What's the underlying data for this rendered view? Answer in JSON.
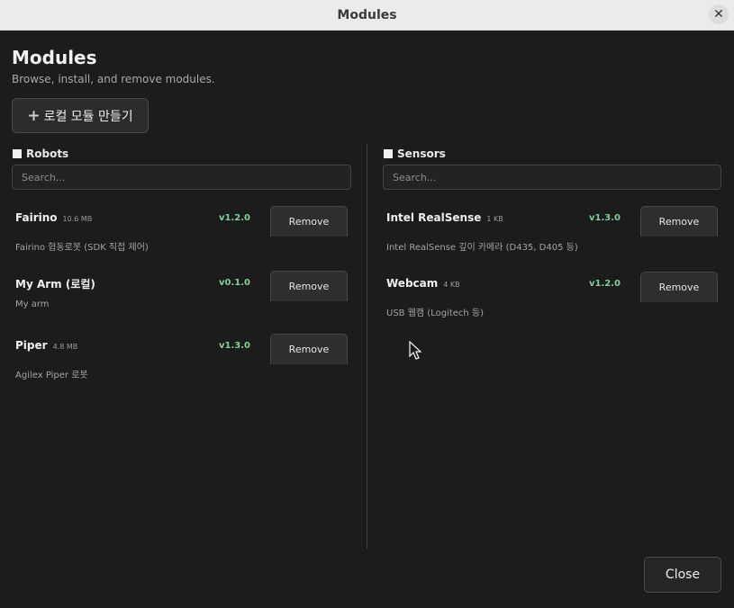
{
  "window": {
    "title": "Modules",
    "close_icon": "close-icon"
  },
  "header": {
    "title": "Modules",
    "subtitle": "Browse, install, and remove modules."
  },
  "toolbar": {
    "create_local_label": "로컬 모듈 만들기",
    "create_local_icon": "plus-icon"
  },
  "robots": {
    "label": "Robots",
    "search_placeholder": "Search...",
    "items": [
      {
        "name": "Fairino",
        "size": "10.6 MB",
        "version": "v1.2.0",
        "description": "Fairino 협동로봇 (SDK 직접 제어)",
        "action": "Remove"
      },
      {
        "name": "My Arm (로컬)",
        "size": "",
        "version": "v0.1.0",
        "description": "My arm",
        "action": "Remove"
      },
      {
        "name": "Piper",
        "size": "4.8 MB",
        "version": "v1.3.0",
        "description": "Agilex Piper 로봇",
        "action": "Remove"
      }
    ]
  },
  "sensors": {
    "label": "Sensors",
    "search_placeholder": "Search...",
    "items": [
      {
        "name": "Intel RealSense",
        "size": "1 KB",
        "version": "v1.3.0",
        "description": "Intel RealSense 깊이 카메라 (D435, D405 등)",
        "action": "Remove"
      },
      {
        "name": "Webcam",
        "size": "4 KB",
        "version": "v1.2.0",
        "description": "USB 웹캠 (Logitech 등)",
        "action": "Remove"
      }
    ]
  },
  "footer": {
    "close_label": "Close"
  },
  "colors": {
    "version_green": "#7ed09a",
    "background": "#1c1c1c",
    "titlebar": "#ebebeb"
  }
}
